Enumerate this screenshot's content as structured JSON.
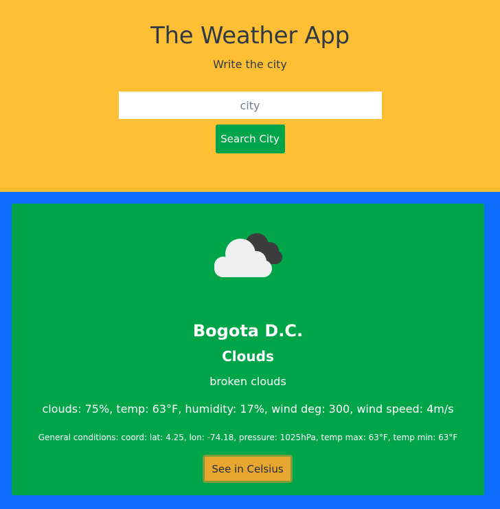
{
  "header": {
    "title": "The Weather App",
    "subtitle": "Write the city",
    "search_placeholder": "city",
    "search_value": "",
    "search_button": "Search City"
  },
  "weather": {
    "icon": "broken-clouds-icon",
    "city": "Bogota D.C.",
    "main": "Clouds",
    "description": "broken clouds",
    "details": "clouds: 75%, temp: 63°F, humidity: 17%, wind deg: 300, wind speed: 4m/s",
    "general": "General conditions: coord: lat: 4.25, lon: -74.18, pressure: 1025hPa, temp max: 63°F, temp min: 63°F",
    "celsius_button": "See in Celsius"
  },
  "colors": {
    "header_bg": "#ffbf35",
    "page_bg": "#0d6efd",
    "card_bg": "#00a54a",
    "button_yellow": "#e7a62f"
  }
}
